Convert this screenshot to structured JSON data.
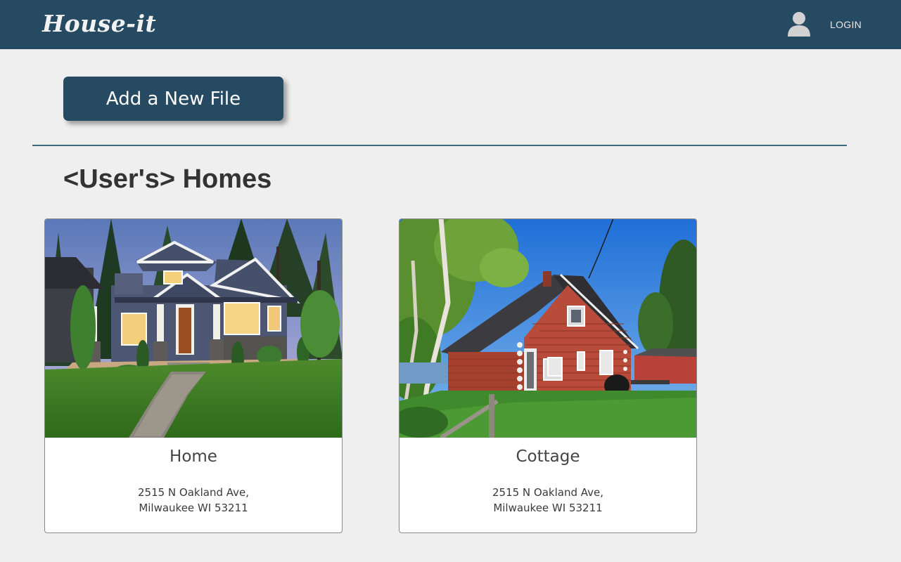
{
  "header": {
    "logo": "House-it",
    "login_label": "LOGIN",
    "user_icon": "user-avatar-icon",
    "background": "#274a63"
  },
  "actions": {
    "add_file_label": "Add a New File"
  },
  "section": {
    "title": "<User's> Homes"
  },
  "homes": [
    {
      "name": "Home",
      "image": "craftsman-house-photo",
      "address_line1": "2515 N Oakland Ave,",
      "address_line2": "Milwaukee WI 53211"
    },
    {
      "name": "Cottage",
      "image": "red-log-cottage-photo",
      "address_line1": "2515 N Oakland Ave,",
      "address_line2": "Milwaukee WI 53211"
    }
  ],
  "colors": {
    "primary": "#274a63",
    "page_background": "#efefef",
    "divider": "#3c6a7a"
  }
}
